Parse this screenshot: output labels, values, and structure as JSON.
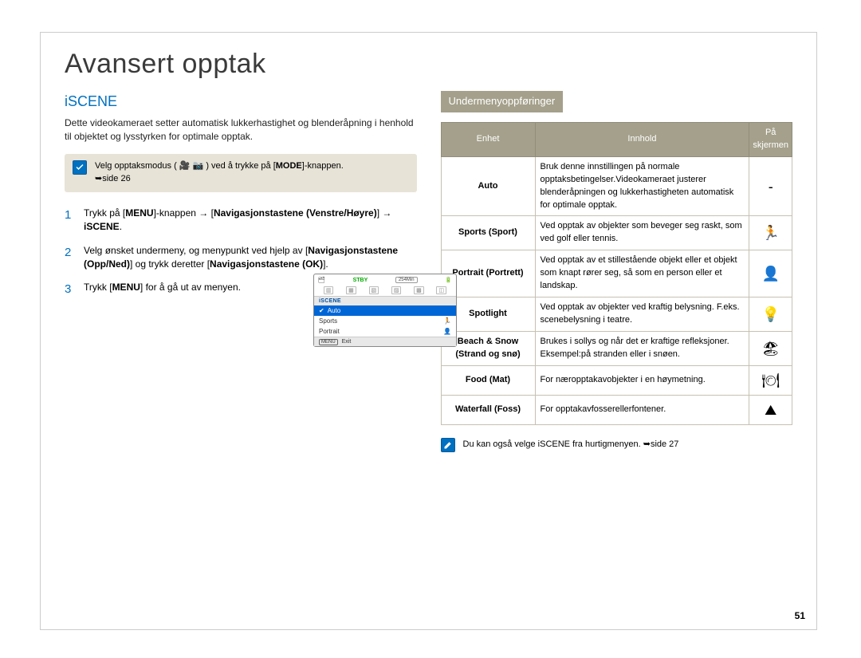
{
  "page_title": "Avansert opptak",
  "section_title": "iSCENE",
  "intro": "Dette videokameraet setter automatisk lukkerhastighet og blenderåpning i henhold til objektet og lysstyrken for optimale opptak.",
  "tip": {
    "text_before": "Velg opptaksmodus (",
    "text_after": ") ved å trykke på [",
    "mode_label": "MODE",
    "text_end": "]-knappen.",
    "ref": "➥side 26"
  },
  "steps": [
    {
      "num": "1",
      "text": "Trykk på [MENU]-knappen → [Navigasjonstastene (Venstre/Høyre)] → iSCENE."
    },
    {
      "num": "2",
      "text": "Velg ønsket undermeny, og menypunkt ved hjelp av [Navigasjonstastene (Opp/Ned)] og trykk deretter [Navigasjonstastene (OK)]."
    },
    {
      "num": "3",
      "text": "Trykk [MENU] for å gå ut av menyen."
    }
  ],
  "lcd": {
    "stby": "STBY",
    "time": "254Min",
    "header": "iSCENE",
    "items": [
      "Auto",
      "Sports",
      "Portrait"
    ],
    "exit_label": "Exit",
    "menu_key": "MENU"
  },
  "submenu_title": "Undermenyoppføringer",
  "table": {
    "headers": [
      "Enhet",
      "Innhold",
      "På skjermen"
    ],
    "rows": [
      {
        "enhet": "Auto",
        "innhold": "Bruk denne innstillingen på normale opptaksbetingelser.Videokameraet justerer blenderåpningen og lukkerhastigheten automatisk for optimale opptak.",
        "icon": "-"
      },
      {
        "enhet": "Sports (Sport)",
        "innhold": "Ved opptak av objekter som beveger seg raskt, som ved golf eller tennis.",
        "icon": "🏃"
      },
      {
        "enhet": "Portrait (Portrett)",
        "innhold": "Ved opptak av et stillestående objekt eller et objekt som knapt rører seg, så som en person eller et landskap.",
        "icon": "👤"
      },
      {
        "enhet": "Spotlight",
        "innhold": "Ved opptak av objekter ved kraftig belysning. F.eks. scenebelysning i teatre.",
        "icon": "💡"
      },
      {
        "enhet": "Beach & Snow (Strand og snø)",
        "innhold": "Brukes i sollys og når det er kraftige refleksjoner. Eksempel:på stranden eller i snøen.",
        "icon": "🏖"
      },
      {
        "enhet": "Food (Mat)",
        "innhold": "For næropptakavobjekter i en høymetning.",
        "icon": "🍽"
      },
      {
        "enhet": "Waterfall (Foss)",
        "innhold": "For opptakavfosserellerfontener.",
        "icon": "⛰"
      }
    ]
  },
  "bottom_note": "Du kan også velge iSCENE fra hurtigmenyen. ➥side 27",
  "page_number": "51"
}
